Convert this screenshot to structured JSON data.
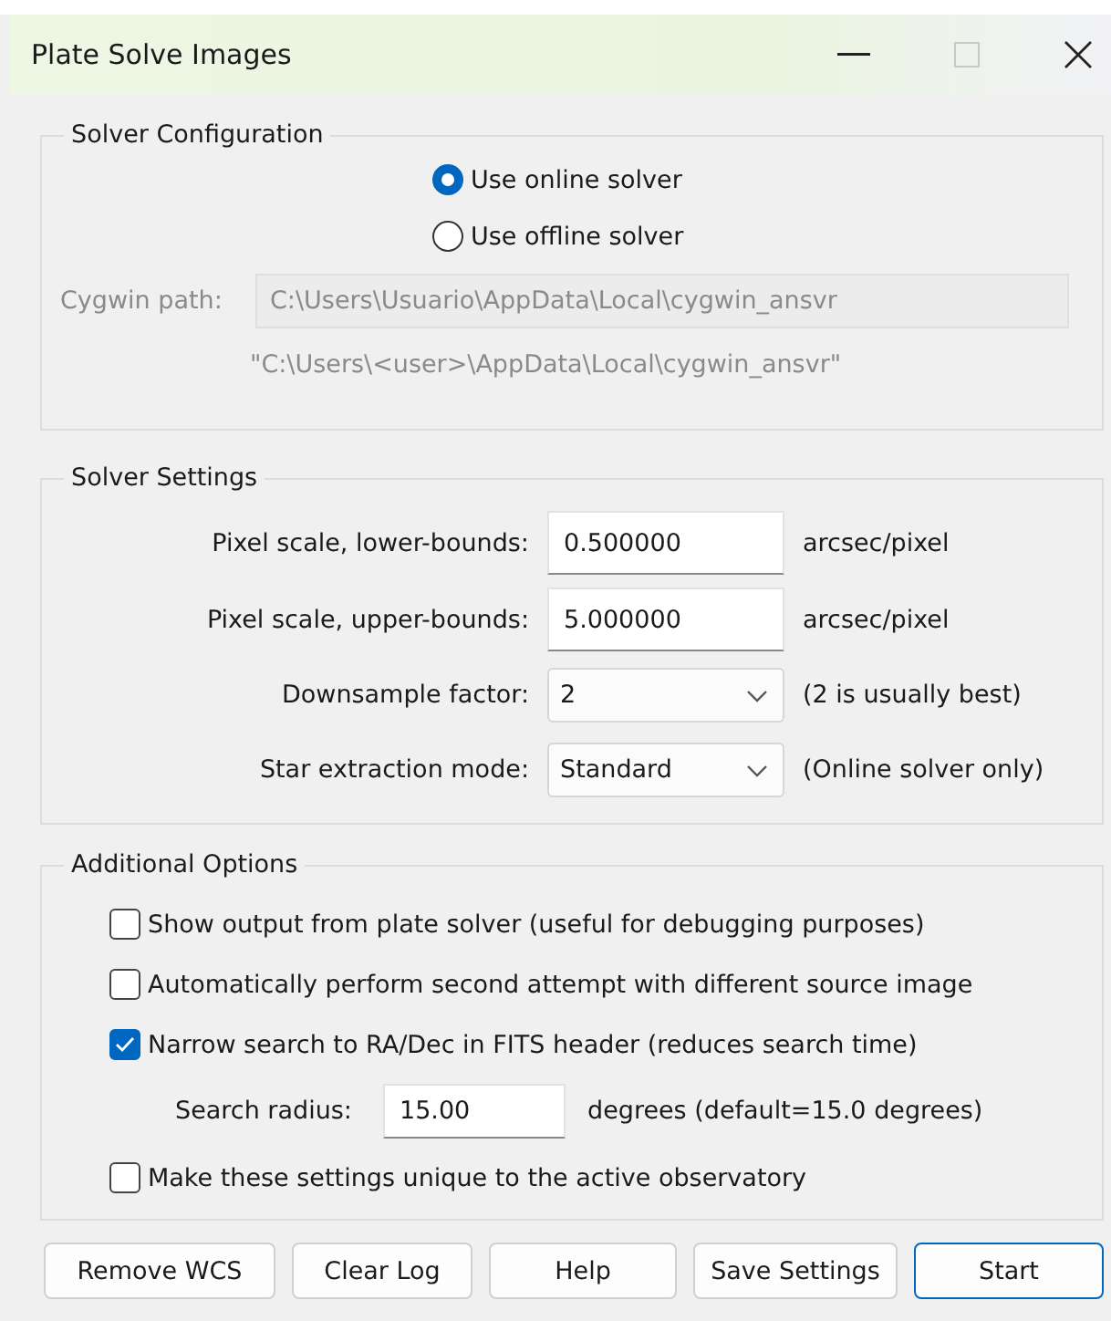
{
  "window": {
    "title": "Plate Solve Images"
  },
  "solver_configuration": {
    "title": "Solver Configuration",
    "options": [
      {
        "label": "Use online solver",
        "selected": true
      },
      {
        "label": "Use offline solver",
        "selected": false
      }
    ],
    "cygwin_path": {
      "label": "Cygwin path:",
      "value": "C:\\Users\\Usuario\\AppData\\Local\\cygwin_ansvr",
      "disabled": true,
      "hint": "\"C:\\Users\\<user>\\AppData\\Local\\cygwin_ansvr\""
    }
  },
  "solver_settings": {
    "title": "Solver Settings",
    "rows": [
      {
        "kind": "text",
        "label": "Pixel scale, lower-bounds:",
        "value": "0.500000",
        "note": "arcsec/pixel"
      },
      {
        "kind": "text",
        "label": "Pixel scale, upper-bounds:",
        "value": "5.000000",
        "note": "arcsec/pixel"
      },
      {
        "kind": "dropdown",
        "label": "Downsample factor:",
        "value": "2",
        "note": "(2 is usually best)"
      },
      {
        "kind": "dropdown",
        "label": "Star extraction mode:",
        "value": "Standard",
        "note": "(Online solver only)"
      }
    ]
  },
  "additional_options": {
    "title": "Additional Options",
    "items": [
      {
        "kind": "checkbox",
        "label": "Show output from plate solver (useful for debugging purposes)",
        "checked": false
      },
      {
        "kind": "checkbox",
        "label": "Automatically perform second attempt with different source image",
        "checked": false
      },
      {
        "kind": "checkbox",
        "label": "Narrow search to RA/Dec in FITS header (reduces search time)",
        "checked": true
      },
      {
        "kind": "field",
        "label": "Search radius:",
        "value": "15.00",
        "note": "degrees (default=15.0 degrees)"
      },
      {
        "kind": "checkbox",
        "label": "Make these settings unique to the active observatory",
        "checked": false
      }
    ]
  },
  "buttons": [
    {
      "label": "Remove WCS",
      "default": false
    },
    {
      "label": "Clear Log",
      "default": false
    },
    {
      "label": "Help",
      "default": false
    },
    {
      "label": "Save Settings",
      "default": false
    },
    {
      "label": "Start",
      "default": true
    }
  ]
}
